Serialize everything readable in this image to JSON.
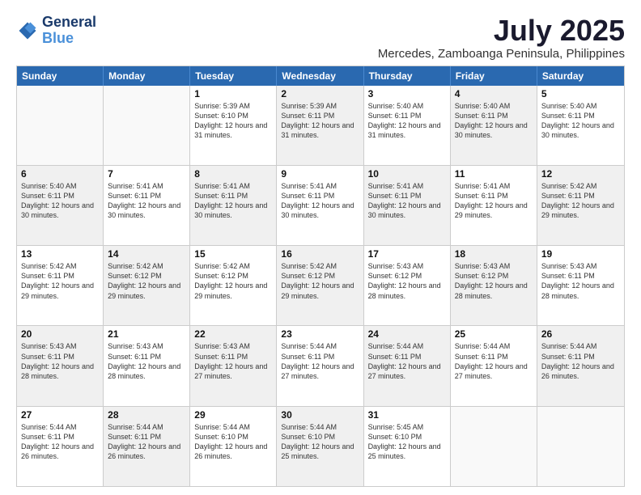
{
  "logo": {
    "line1": "General",
    "line2": "Blue"
  },
  "title": "July 2025",
  "subtitle": "Mercedes, Zamboanga Peninsula, Philippines",
  "header_days": [
    "Sunday",
    "Monday",
    "Tuesday",
    "Wednesday",
    "Thursday",
    "Friday",
    "Saturday"
  ],
  "weeks": [
    [
      {
        "day": "",
        "sunrise": "",
        "sunset": "",
        "daylight": "",
        "shaded": false,
        "empty": true
      },
      {
        "day": "",
        "sunrise": "",
        "sunset": "",
        "daylight": "",
        "shaded": false,
        "empty": true
      },
      {
        "day": "1",
        "sunrise": "Sunrise: 5:39 AM",
        "sunset": "Sunset: 6:10 PM",
        "daylight": "Daylight: 12 hours and 31 minutes.",
        "shaded": false,
        "empty": false
      },
      {
        "day": "2",
        "sunrise": "Sunrise: 5:39 AM",
        "sunset": "Sunset: 6:11 PM",
        "daylight": "Daylight: 12 hours and 31 minutes.",
        "shaded": true,
        "empty": false
      },
      {
        "day": "3",
        "sunrise": "Sunrise: 5:40 AM",
        "sunset": "Sunset: 6:11 PM",
        "daylight": "Daylight: 12 hours and 31 minutes.",
        "shaded": false,
        "empty": false
      },
      {
        "day": "4",
        "sunrise": "Sunrise: 5:40 AM",
        "sunset": "Sunset: 6:11 PM",
        "daylight": "Daylight: 12 hours and 30 minutes.",
        "shaded": true,
        "empty": false
      },
      {
        "day": "5",
        "sunrise": "Sunrise: 5:40 AM",
        "sunset": "Sunset: 6:11 PM",
        "daylight": "Daylight: 12 hours and 30 minutes.",
        "shaded": false,
        "empty": false
      }
    ],
    [
      {
        "day": "6",
        "sunrise": "Sunrise: 5:40 AM",
        "sunset": "Sunset: 6:11 PM",
        "daylight": "Daylight: 12 hours and 30 minutes.",
        "shaded": true,
        "empty": false
      },
      {
        "day": "7",
        "sunrise": "Sunrise: 5:41 AM",
        "sunset": "Sunset: 6:11 PM",
        "daylight": "Daylight: 12 hours and 30 minutes.",
        "shaded": false,
        "empty": false
      },
      {
        "day": "8",
        "sunrise": "Sunrise: 5:41 AM",
        "sunset": "Sunset: 6:11 PM",
        "daylight": "Daylight: 12 hours and 30 minutes.",
        "shaded": true,
        "empty": false
      },
      {
        "day": "9",
        "sunrise": "Sunrise: 5:41 AM",
        "sunset": "Sunset: 6:11 PM",
        "daylight": "Daylight: 12 hours and 30 minutes.",
        "shaded": false,
        "empty": false
      },
      {
        "day": "10",
        "sunrise": "Sunrise: 5:41 AM",
        "sunset": "Sunset: 6:11 PM",
        "daylight": "Daylight: 12 hours and 30 minutes.",
        "shaded": true,
        "empty": false
      },
      {
        "day": "11",
        "sunrise": "Sunrise: 5:41 AM",
        "sunset": "Sunset: 6:11 PM",
        "daylight": "Daylight: 12 hours and 29 minutes.",
        "shaded": false,
        "empty": false
      },
      {
        "day": "12",
        "sunrise": "Sunrise: 5:42 AM",
        "sunset": "Sunset: 6:11 PM",
        "daylight": "Daylight: 12 hours and 29 minutes.",
        "shaded": true,
        "empty": false
      }
    ],
    [
      {
        "day": "13",
        "sunrise": "Sunrise: 5:42 AM",
        "sunset": "Sunset: 6:11 PM",
        "daylight": "Daylight: 12 hours and 29 minutes.",
        "shaded": false,
        "empty": false
      },
      {
        "day": "14",
        "sunrise": "Sunrise: 5:42 AM",
        "sunset": "Sunset: 6:12 PM",
        "daylight": "Daylight: 12 hours and 29 minutes.",
        "shaded": true,
        "empty": false
      },
      {
        "day": "15",
        "sunrise": "Sunrise: 5:42 AM",
        "sunset": "Sunset: 6:12 PM",
        "daylight": "Daylight: 12 hours and 29 minutes.",
        "shaded": false,
        "empty": false
      },
      {
        "day": "16",
        "sunrise": "Sunrise: 5:42 AM",
        "sunset": "Sunset: 6:12 PM",
        "daylight": "Daylight: 12 hours and 29 minutes.",
        "shaded": true,
        "empty": false
      },
      {
        "day": "17",
        "sunrise": "Sunrise: 5:43 AM",
        "sunset": "Sunset: 6:12 PM",
        "daylight": "Daylight: 12 hours and 28 minutes.",
        "shaded": false,
        "empty": false
      },
      {
        "day": "18",
        "sunrise": "Sunrise: 5:43 AM",
        "sunset": "Sunset: 6:12 PM",
        "daylight": "Daylight: 12 hours and 28 minutes.",
        "shaded": true,
        "empty": false
      },
      {
        "day": "19",
        "sunrise": "Sunrise: 5:43 AM",
        "sunset": "Sunset: 6:11 PM",
        "daylight": "Daylight: 12 hours and 28 minutes.",
        "shaded": false,
        "empty": false
      }
    ],
    [
      {
        "day": "20",
        "sunrise": "Sunrise: 5:43 AM",
        "sunset": "Sunset: 6:11 PM",
        "daylight": "Daylight: 12 hours and 28 minutes.",
        "shaded": true,
        "empty": false
      },
      {
        "day": "21",
        "sunrise": "Sunrise: 5:43 AM",
        "sunset": "Sunset: 6:11 PM",
        "daylight": "Daylight: 12 hours and 28 minutes.",
        "shaded": false,
        "empty": false
      },
      {
        "day": "22",
        "sunrise": "Sunrise: 5:43 AM",
        "sunset": "Sunset: 6:11 PM",
        "daylight": "Daylight: 12 hours and 27 minutes.",
        "shaded": true,
        "empty": false
      },
      {
        "day": "23",
        "sunrise": "Sunrise: 5:44 AM",
        "sunset": "Sunset: 6:11 PM",
        "daylight": "Daylight: 12 hours and 27 minutes.",
        "shaded": false,
        "empty": false
      },
      {
        "day": "24",
        "sunrise": "Sunrise: 5:44 AM",
        "sunset": "Sunset: 6:11 PM",
        "daylight": "Daylight: 12 hours and 27 minutes.",
        "shaded": true,
        "empty": false
      },
      {
        "day": "25",
        "sunrise": "Sunrise: 5:44 AM",
        "sunset": "Sunset: 6:11 PM",
        "daylight": "Daylight: 12 hours and 27 minutes.",
        "shaded": false,
        "empty": false
      },
      {
        "day": "26",
        "sunrise": "Sunrise: 5:44 AM",
        "sunset": "Sunset: 6:11 PM",
        "daylight": "Daylight: 12 hours and 26 minutes.",
        "shaded": true,
        "empty": false
      }
    ],
    [
      {
        "day": "27",
        "sunrise": "Sunrise: 5:44 AM",
        "sunset": "Sunset: 6:11 PM",
        "daylight": "Daylight: 12 hours and 26 minutes.",
        "shaded": false,
        "empty": false
      },
      {
        "day": "28",
        "sunrise": "Sunrise: 5:44 AM",
        "sunset": "Sunset: 6:11 PM",
        "daylight": "Daylight: 12 hours and 26 minutes.",
        "shaded": true,
        "empty": false
      },
      {
        "day": "29",
        "sunrise": "Sunrise: 5:44 AM",
        "sunset": "Sunset: 6:10 PM",
        "daylight": "Daylight: 12 hours and 26 minutes.",
        "shaded": false,
        "empty": false
      },
      {
        "day": "30",
        "sunrise": "Sunrise: 5:44 AM",
        "sunset": "Sunset: 6:10 PM",
        "daylight": "Daylight: 12 hours and 25 minutes.",
        "shaded": true,
        "empty": false
      },
      {
        "day": "31",
        "sunrise": "Sunrise: 5:45 AM",
        "sunset": "Sunset: 6:10 PM",
        "daylight": "Daylight: 12 hours and 25 minutes.",
        "shaded": false,
        "empty": false
      },
      {
        "day": "",
        "sunrise": "",
        "sunset": "",
        "daylight": "",
        "shaded": true,
        "empty": true
      },
      {
        "day": "",
        "sunrise": "",
        "sunset": "",
        "daylight": "",
        "shaded": false,
        "empty": true
      }
    ]
  ]
}
